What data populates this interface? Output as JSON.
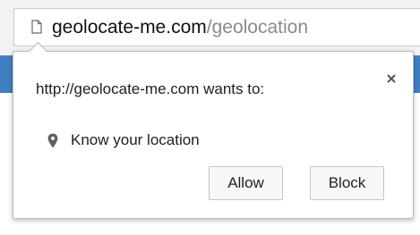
{
  "omnibox": {
    "domain": "geolocate-me.com",
    "path": "/geolocation",
    "page_icon": "page-icon"
  },
  "permission_bubble": {
    "title": "http://geolocate-me.com wants to:",
    "close_icon": "close-icon",
    "permission": {
      "icon": "location-pin-icon",
      "label": "Know your location"
    },
    "allow_label": "Allow",
    "block_label": "Block"
  },
  "colors": {
    "page_header_blue": "#3f7fc1",
    "toolbar_bg": "#f2f2f2",
    "url_domain": "#111111",
    "url_path": "#8a8a8a"
  }
}
